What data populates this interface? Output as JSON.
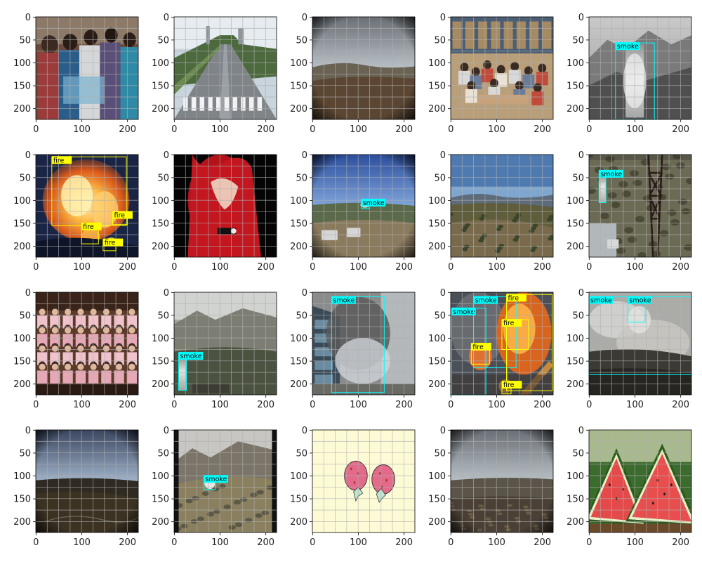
{
  "axes": {
    "x_ticks": [
      0,
      100,
      200
    ],
    "y_ticks": [
      0,
      50,
      100,
      150,
      200
    ],
    "xlim": [
      0,
      224
    ],
    "ylim": [
      224,
      0
    ],
    "grid": true
  },
  "colors": {
    "smoke": "#00ffff",
    "fire": "#ffff00"
  },
  "panels": [
    {
      "scene": "people-costume-indoor",
      "detections": []
    },
    {
      "scene": "highway-road",
      "detections": []
    },
    {
      "scene": "fisheye-landscape-cloudy",
      "detections": []
    },
    {
      "scene": "library-students",
      "detections": []
    },
    {
      "scene": "mountain-smoke",
      "detections": [
        {
          "label": "smoke",
          "x": 58,
          "y": 57,
          "w": 85,
          "h": 167
        }
      ]
    },
    {
      "scene": "night-fire",
      "detections": [
        {
          "label": "fire",
          "x": 35,
          "y": 5,
          "w": 163,
          "h": 150
        },
        {
          "label": "fire",
          "x": 100,
          "y": 150,
          "w": 37,
          "h": 45
        },
        {
          "label": "fire",
          "x": 168,
          "y": 125,
          "w": 32,
          "h": 28
        },
        {
          "label": "fire",
          "x": 147,
          "y": 185,
          "w": 28,
          "h": 25
        }
      ]
    },
    {
      "scene": "red-shirt-closeup",
      "detections": []
    },
    {
      "scene": "fisheye-sky-village",
      "detections": [
        {
          "label": "smoke",
          "x": 107,
          "y": 98,
          "w": 17,
          "h": 20
        }
      ]
    },
    {
      "scene": "shrubland-landscape",
      "detections": []
    },
    {
      "scene": "tower-forest-smoke",
      "detections": [
        {
          "label": "smoke",
          "x": 22,
          "y": 35,
          "w": 15,
          "h": 70
        }
      ]
    },
    {
      "scene": "group-photo",
      "detections": []
    },
    {
      "scene": "mountain-smoke-hazy",
      "detections": [
        {
          "label": "smoke",
          "x": 10,
          "y": 132,
          "w": 17,
          "h": 82
        }
      ]
    },
    {
      "scene": "building-smoke",
      "detections": [
        {
          "label": "smoke",
          "x": 42,
          "y": 10,
          "w": 115,
          "h": 209
        }
      ]
    },
    {
      "scene": "building-fire-smoke",
      "detections": [
        {
          "label": "smoke",
          "x": 2,
          "y": 35,
          "w": 75,
          "h": 189
        },
        {
          "label": "smoke",
          "x": 50,
          "y": 10,
          "w": 93,
          "h": 155
        },
        {
          "label": "fire",
          "x": 122,
          "y": 5,
          "w": 100,
          "h": 210
        },
        {
          "label": "fire",
          "x": 112,
          "y": 60,
          "w": 58,
          "h": 65
        },
        {
          "label": "fire",
          "x": 45,
          "y": 112,
          "w": 40,
          "h": 45
        },
        {
          "label": "fire",
          "x": 112,
          "y": 195,
          "w": 20,
          "h": 27
        }
      ]
    },
    {
      "scene": "landscape-smoke",
      "detections": [
        {
          "label": "smoke",
          "x": 0,
          "y": 10,
          "w": 224,
          "h": 170
        },
        {
          "label": "smoke",
          "x": 85,
          "y": 10,
          "w": 38,
          "h": 55
        }
      ]
    },
    {
      "scene": "fisheye-valley-dusk",
      "detections": []
    },
    {
      "scene": "hills-smoke",
      "detections": [
        {
          "label": "smoke",
          "x": 65,
          "y": 100,
          "w": 25,
          "h": 30
        }
      ]
    },
    {
      "scene": "strawberry-cartoon",
      "detections": []
    },
    {
      "scene": "fisheye-dry-field",
      "detections": []
    },
    {
      "scene": "watermelon",
      "detections": []
    }
  ]
}
